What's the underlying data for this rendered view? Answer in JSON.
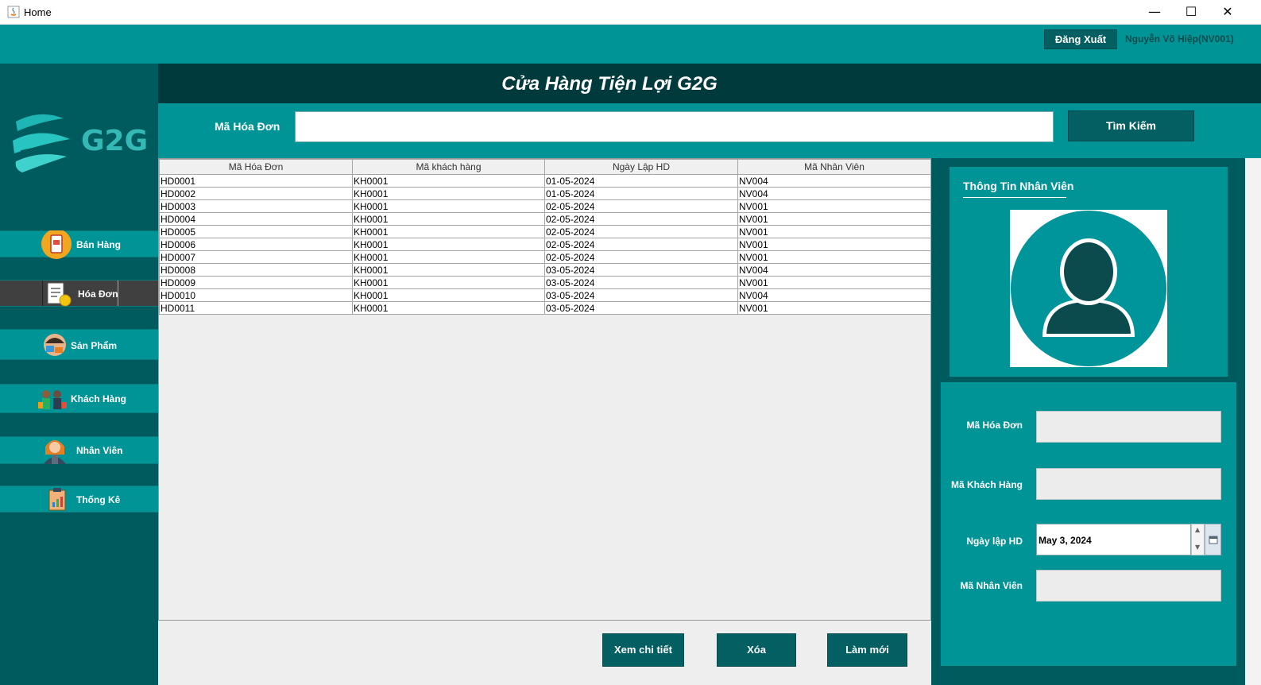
{
  "window": {
    "title": "Home",
    "minimize": "—",
    "maximize": "☐",
    "close": "✕"
  },
  "topbar": {
    "logout": "Đăng Xuất",
    "user": "Nguyễn Võ Hiệp(NV001)"
  },
  "logo": {
    "text": "G2G"
  },
  "sidebar": {
    "items": [
      {
        "label": "Bán Hàng",
        "icon": "phone-cart-icon"
      },
      {
        "label": "Hóa Đơn",
        "icon": "invoice-icon"
      },
      {
        "label": "Sản  Phẩm",
        "icon": "product-icon"
      },
      {
        "label": "Khách Hàng",
        "icon": "customers-icon"
      },
      {
        "label": "Nhân Viên",
        "icon": "employee-icon"
      },
      {
        "label": "Thống Kê",
        "icon": "statistics-icon"
      }
    ]
  },
  "header": {
    "title": "Cửa Hàng Tiện Lợi G2G"
  },
  "search": {
    "label": "Mã Hóa Đơn",
    "value": "",
    "button": "Tìm Kiếm"
  },
  "table": {
    "columns": [
      "Mã Hóa Đơn",
      "Mã khách hàng",
      "Ngày Lập HD",
      "Mã Nhân Viên"
    ],
    "rows": [
      [
        "HD0001",
        "KH0001",
        "01-05-2024",
        "NV004"
      ],
      [
        "HD0002",
        "KH0001",
        "01-05-2024",
        "NV004"
      ],
      [
        "HD0003",
        "KH0001",
        "02-05-2024",
        "NV001"
      ],
      [
        "HD0004",
        "KH0001",
        "02-05-2024",
        "NV001"
      ],
      [
        "HD0005",
        "KH0001",
        "02-05-2024",
        "NV001"
      ],
      [
        "HD0006",
        "KH0001",
        "02-05-2024",
        "NV001"
      ],
      [
        "HD0007",
        "KH0001",
        "02-05-2024",
        "NV001"
      ],
      [
        "HD0008",
        "KH0001",
        "03-05-2024",
        "NV004"
      ],
      [
        "HD0009",
        "KH0001",
        "03-05-2024",
        "NV001"
      ],
      [
        "HD0010",
        "KH0001",
        "03-05-2024",
        "NV004"
      ],
      [
        "HD0011",
        "KH0001",
        "03-05-2024",
        "NV001"
      ]
    ]
  },
  "actions": {
    "detail": "Xem chi tiết",
    "delete": "Xóa",
    "refresh": "Làm mới"
  },
  "panel": {
    "title": "Thông Tin Nhân Viên",
    "fields": {
      "invoice_label": "Mã Hóa Đơn",
      "invoice_value": "",
      "customer_label": "Mã Khách Hàng",
      "customer_value": "",
      "date_label": "Ngày lập HD",
      "date_value": "May 3, 2024",
      "employee_label": "Mã Nhân Viên",
      "employee_value": ""
    }
  },
  "colors": {
    "teal": "#009497",
    "dark_teal": "#005b5f",
    "header_dark": "#003a3c",
    "button": "#035f61"
  }
}
